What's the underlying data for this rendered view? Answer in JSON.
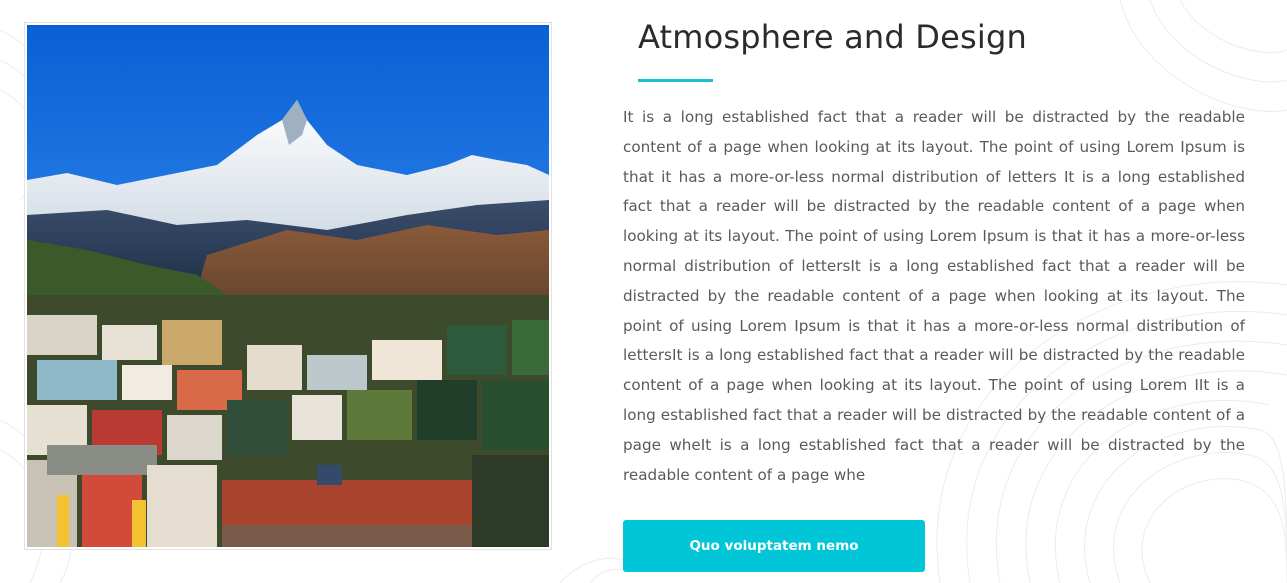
{
  "feature": {
    "image": {
      "subject": "snow-capped mountain peak above a hillside town",
      "icon": "landscape-photo"
    },
    "heading": "Atmosphere and Design",
    "body": "It is a long established fact that a reader will be distracted by the readable content of a page when looking at its layout. The point of using Lorem Ipsum is that it has a more-or-less normal distribution of letters It is a long established fact that a reader will be distracted by the readable content of a page when looking at its layout. The point of using Lorem Ipsum is that it has a more-or-less normal distribution of lettersIt is a long established fact that a reader will be distracted by the readable content of a page when looking at its layout. The point of using Lorem Ipsum is that it has a more-or-less normal distribution of lettersIt is a long established fact that a reader will be distracted by the readable content of a page when looking at its layout. The point of using Lorem IIt is a long established fact that a reader will be distracted by the readable content of a page wheIt is a long established fact that a reader will be distracted by the readable content of a page whe",
    "button_label": "Quo voluptatem nemo"
  },
  "colors": {
    "accent": "#00c6d7",
    "heading_rule": "#18bfd2",
    "heading_text": "#2b2b2b",
    "body_text": "#5a5a5a"
  }
}
